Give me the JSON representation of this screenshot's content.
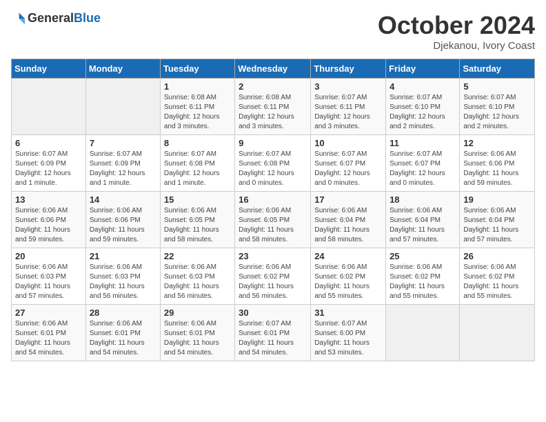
{
  "header": {
    "logo": {
      "general": "General",
      "blue": "Blue"
    },
    "title": "October 2024",
    "location": "Djekanou, Ivory Coast"
  },
  "days_of_week": [
    "Sunday",
    "Monday",
    "Tuesday",
    "Wednesday",
    "Thursday",
    "Friday",
    "Saturday"
  ],
  "weeks": [
    [
      null,
      null,
      {
        "day": 1,
        "sunrise": "6:08 AM",
        "sunset": "6:11 PM",
        "daylight": "12 hours and 3 minutes."
      },
      {
        "day": 2,
        "sunrise": "6:08 AM",
        "sunset": "6:11 PM",
        "daylight": "12 hours and 3 minutes."
      },
      {
        "day": 3,
        "sunrise": "6:07 AM",
        "sunset": "6:11 PM",
        "daylight": "12 hours and 3 minutes."
      },
      {
        "day": 4,
        "sunrise": "6:07 AM",
        "sunset": "6:10 PM",
        "daylight": "12 hours and 2 minutes."
      },
      {
        "day": 5,
        "sunrise": "6:07 AM",
        "sunset": "6:10 PM",
        "daylight": "12 hours and 2 minutes."
      }
    ],
    [
      {
        "day": 6,
        "sunrise": "6:07 AM",
        "sunset": "6:09 PM",
        "daylight": "12 hours and 1 minute."
      },
      {
        "day": 7,
        "sunrise": "6:07 AM",
        "sunset": "6:09 PM",
        "daylight": "12 hours and 1 minute."
      },
      {
        "day": 8,
        "sunrise": "6:07 AM",
        "sunset": "6:08 PM",
        "daylight": "12 hours and 1 minute."
      },
      {
        "day": 9,
        "sunrise": "6:07 AM",
        "sunset": "6:08 PM",
        "daylight": "12 hours and 0 minutes."
      },
      {
        "day": 10,
        "sunrise": "6:07 AM",
        "sunset": "6:07 PM",
        "daylight": "12 hours and 0 minutes."
      },
      {
        "day": 11,
        "sunrise": "6:07 AM",
        "sunset": "6:07 PM",
        "daylight": "12 hours and 0 minutes."
      },
      {
        "day": 12,
        "sunrise": "6:06 AM",
        "sunset": "6:06 PM",
        "daylight": "11 hours and 59 minutes."
      }
    ],
    [
      {
        "day": 13,
        "sunrise": "6:06 AM",
        "sunset": "6:06 PM",
        "daylight": "11 hours and 59 minutes."
      },
      {
        "day": 14,
        "sunrise": "6:06 AM",
        "sunset": "6:06 PM",
        "daylight": "11 hours and 59 minutes."
      },
      {
        "day": 15,
        "sunrise": "6:06 AM",
        "sunset": "6:05 PM",
        "daylight": "11 hours and 58 minutes."
      },
      {
        "day": 16,
        "sunrise": "6:06 AM",
        "sunset": "6:05 PM",
        "daylight": "11 hours and 58 minutes."
      },
      {
        "day": 17,
        "sunrise": "6:06 AM",
        "sunset": "6:04 PM",
        "daylight": "11 hours and 58 minutes."
      },
      {
        "day": 18,
        "sunrise": "6:06 AM",
        "sunset": "6:04 PM",
        "daylight": "11 hours and 57 minutes."
      },
      {
        "day": 19,
        "sunrise": "6:06 AM",
        "sunset": "6:04 PM",
        "daylight": "11 hours and 57 minutes."
      }
    ],
    [
      {
        "day": 20,
        "sunrise": "6:06 AM",
        "sunset": "6:03 PM",
        "daylight": "11 hours and 57 minutes."
      },
      {
        "day": 21,
        "sunrise": "6:06 AM",
        "sunset": "6:03 PM",
        "daylight": "11 hours and 56 minutes."
      },
      {
        "day": 22,
        "sunrise": "6:06 AM",
        "sunset": "6:03 PM",
        "daylight": "11 hours and 56 minutes."
      },
      {
        "day": 23,
        "sunrise": "6:06 AM",
        "sunset": "6:02 PM",
        "daylight": "11 hours and 56 minutes."
      },
      {
        "day": 24,
        "sunrise": "6:06 AM",
        "sunset": "6:02 PM",
        "daylight": "11 hours and 55 minutes."
      },
      {
        "day": 25,
        "sunrise": "6:06 AM",
        "sunset": "6:02 PM",
        "daylight": "11 hours and 55 minutes."
      },
      {
        "day": 26,
        "sunrise": "6:06 AM",
        "sunset": "6:02 PM",
        "daylight": "11 hours and 55 minutes."
      }
    ],
    [
      {
        "day": 27,
        "sunrise": "6:06 AM",
        "sunset": "6:01 PM",
        "daylight": "11 hours and 54 minutes."
      },
      {
        "day": 28,
        "sunrise": "6:06 AM",
        "sunset": "6:01 PM",
        "daylight": "11 hours and 54 minutes."
      },
      {
        "day": 29,
        "sunrise": "6:06 AM",
        "sunset": "6:01 PM",
        "daylight": "11 hours and 54 minutes."
      },
      {
        "day": 30,
        "sunrise": "6:07 AM",
        "sunset": "6:01 PM",
        "daylight": "11 hours and 54 minutes."
      },
      {
        "day": 31,
        "sunrise": "6:07 AM",
        "sunset": "6:00 PM",
        "daylight": "11 hours and 53 minutes."
      },
      null,
      null
    ]
  ],
  "labels": {
    "sunrise_prefix": "Sunrise: ",
    "sunset_prefix": "Sunset: ",
    "daylight_prefix": "Daylight: "
  }
}
